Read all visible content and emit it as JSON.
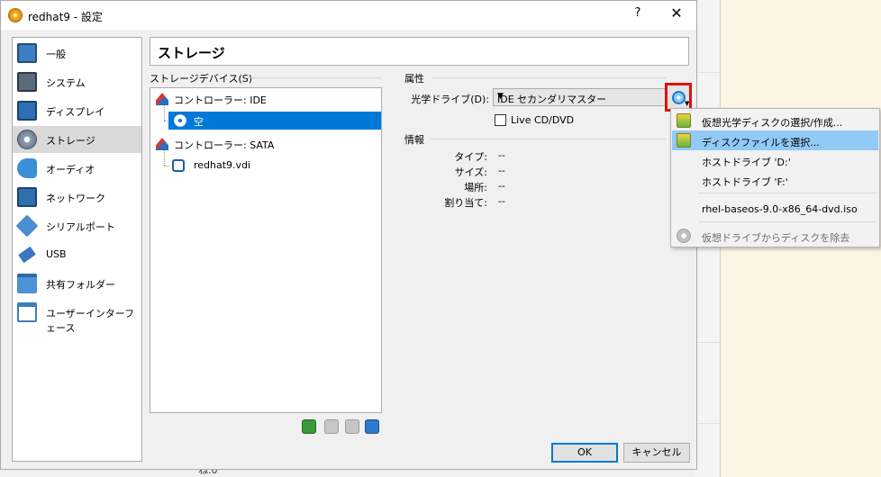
{
  "window": {
    "title": "redhat9 - 設定",
    "help_label": "?",
    "close_label": "✕"
  },
  "background": {
    "strip_text": "ね.0"
  },
  "sidebar": {
    "items": [
      {
        "label": "一般",
        "icon": "general-icon",
        "color": "#3d7fc4"
      },
      {
        "label": "システム",
        "icon": "system-icon",
        "color": "#5a6b7b"
      },
      {
        "label": "ディスプレイ",
        "icon": "display-icon",
        "color": "#2c6fb7"
      },
      {
        "label": "ストレージ",
        "icon": "storage-icon",
        "color": "#6d7d8d"
      },
      {
        "label": "オーディオ",
        "icon": "audio-icon",
        "color": "#3a8fd8"
      },
      {
        "label": "ネットワーク",
        "icon": "network-icon",
        "color": "#2f6fb0"
      },
      {
        "label": "シリアルポート",
        "icon": "serial-port-icon",
        "color": "#4a8ed0"
      },
      {
        "label": "USB",
        "icon": "usb-icon",
        "color": "#3a78c2"
      },
      {
        "label": "共有フォルダー",
        "icon": "shared-folder-icon",
        "color": "#4b92d6"
      },
      {
        "label": "ユーザーインターフェース",
        "icon": "user-interface-icon",
        "color": "#3c7ec0"
      }
    ],
    "selected_index": 3
  },
  "page": {
    "title": "ストレージ"
  },
  "storage_devices": {
    "group_label": "ストレージデバイス(S)",
    "tree": [
      {
        "label": "コントローラー: IDE",
        "icon": "ide-controller-icon"
      },
      {
        "label": "空",
        "icon": "optical-disc-icon",
        "selected": true
      },
      {
        "label": "コントローラー: SATA",
        "icon": "sata-controller-icon"
      },
      {
        "label": "redhat9.vdi",
        "icon": "hard-disk-icon"
      }
    ],
    "toolbar": [
      {
        "icon": "add-controller-icon",
        "color": "#3a9a3a"
      },
      {
        "icon": "add-attachment-icon",
        "color": "#b0b0b0"
      },
      {
        "icon": "remove-attachment-icon",
        "color": "#b0b0b0"
      },
      {
        "icon": "remove-controller-icon",
        "color": "#2d7bd0"
      }
    ]
  },
  "attributes": {
    "group_label": "属性",
    "optical_drive_label": "光学ドライブ(D):",
    "optical_drive_value": "IDE セカンダリマスター",
    "live_cd_label": "Live CD/DVD",
    "live_cd_checked": false
  },
  "info": {
    "group_label": "情報",
    "rows": [
      {
        "label": "タイプ:",
        "value": "--"
      },
      {
        "label": "サイズ:",
        "value": "--"
      },
      {
        "label": "場所:",
        "value": "--"
      },
      {
        "label": "割り当て:",
        "value": "--"
      }
    ]
  },
  "disc_menu": {
    "items": [
      {
        "label": "仮想光学ディスクの選択/作成...",
        "icon": "virtual-optical-disk-icon"
      },
      {
        "label": "ディスクファイルを選択...",
        "icon": "choose-disk-file-icon",
        "hover": true
      },
      {
        "label": "ホストドライブ 'D:'"
      },
      {
        "label": "ホストドライブ 'F:'"
      },
      {
        "label": "rhel-baseos-9.0-x86_64-dvd.iso"
      },
      {
        "label": "仮想ドライブからディスクを除去",
        "icon": "remove-disk-icon",
        "disabled": true
      }
    ]
  },
  "buttons": {
    "ok_label": "OK",
    "cancel_label": "キャンセル"
  },
  "colors": {
    "selection": "#0078d7",
    "menu_hover": "#91c9f7",
    "highlight_frame": "#e01010"
  }
}
